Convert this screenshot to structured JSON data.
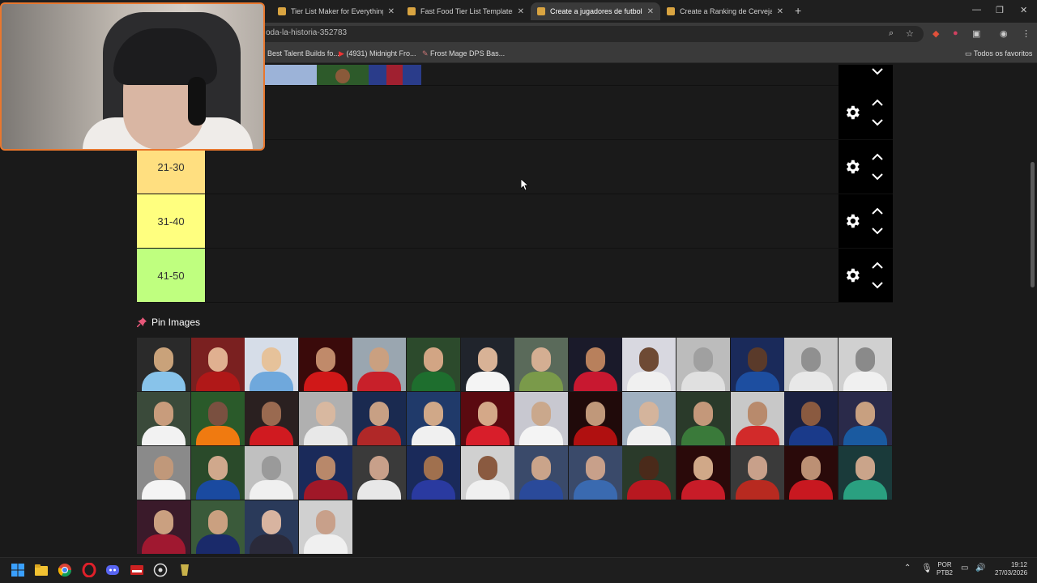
{
  "browser": {
    "tabs": [
      {
        "title": "Tier List Maker for Everything -",
        "active": false
      },
      {
        "title": "Fast Food Tier List Templates -",
        "active": false
      },
      {
        "title": "Create a jugadores de futbol de",
        "active": true
      },
      {
        "title": "Create a Ranking de Cerveja Co",
        "active": false
      }
    ],
    "url": "oda-la-historia-352783",
    "bookmarks": [
      "Best Talent Builds fo...",
      "(4931) Midnight Fro...",
      "Frost Mage DPS Bas..."
    ],
    "favorites_label": "Todos os favoritos"
  },
  "tiers": [
    {
      "label": "",
      "color": "#1a1a1a"
    },
    {
      "label": "21-30",
      "color": "#ffdf80"
    },
    {
      "label": "31-40",
      "color": "#ffff7f"
    },
    {
      "label": "41-50",
      "color": "#bfff7f"
    }
  ],
  "pin_section": {
    "title": "Pin Images"
  },
  "taskbar": {
    "lang": "POR",
    "layout": "PTB2",
    "time": "19:12",
    "date": "27/03/2026"
  },
  "colors": {
    "accent": "#e8772e",
    "control_bg": "#000000"
  }
}
